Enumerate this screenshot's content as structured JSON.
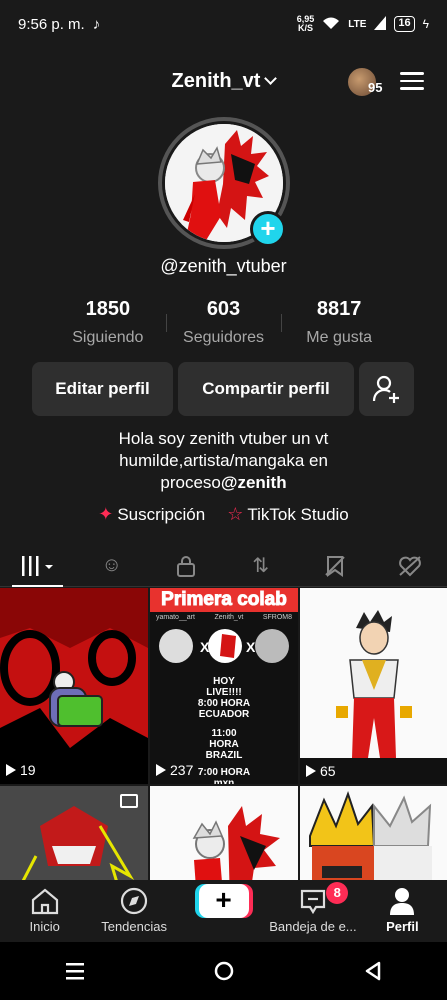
{
  "status": {
    "time": "9:56 p. m.",
    "speed_top": "6,95",
    "speed_bottom": "K/S",
    "network": "LTE",
    "battery": "16"
  },
  "header": {
    "username": "Zenith_vt",
    "story_count": "95"
  },
  "profile": {
    "handle": "@zenith_vtuber"
  },
  "stats": [
    {
      "value": "1850",
      "label": "Siguiendo"
    },
    {
      "value": "603",
      "label": "Seguidores"
    },
    {
      "value": "8817",
      "label": "Me gusta"
    }
  ],
  "buttons": {
    "edit": "Editar perfil",
    "share": "Compartir perfil"
  },
  "bio": {
    "line1": "Hola soy zenith vtuber un vt",
    "line2": "humilde,artista/mangaka en",
    "line3_plain": "proceso",
    "line3_mention": "@zenith"
  },
  "links": {
    "subscription": "Suscripción",
    "studio": "TikTok Studio"
  },
  "videos": [
    {
      "views": "19"
    },
    {
      "views": "237",
      "title": "Primera colab",
      "sub1": "yamato__art",
      "sub2": "Zenith_vt",
      "sub3": "SFROM8",
      "text": [
        "HOY",
        "LIVE!!!!",
        "8:00 HORA",
        "ECUADOR",
        "11:00",
        "HORA",
        "BRAZIL",
        "7:00 HORA",
        "mxn"
      ]
    },
    {
      "views": "65"
    },
    {
      "views": ""
    },
    {
      "views": ""
    },
    {
      "views": ""
    }
  ],
  "nav": {
    "home": "Inicio",
    "discover": "Tendencias",
    "inbox": "Bandeja de e...",
    "inbox_badge": "8",
    "profile": "Perfil"
  },
  "colors": {
    "accent": "#fe2c55",
    "cyan": "#20d5ec",
    "bg": "#1a1a1a"
  }
}
